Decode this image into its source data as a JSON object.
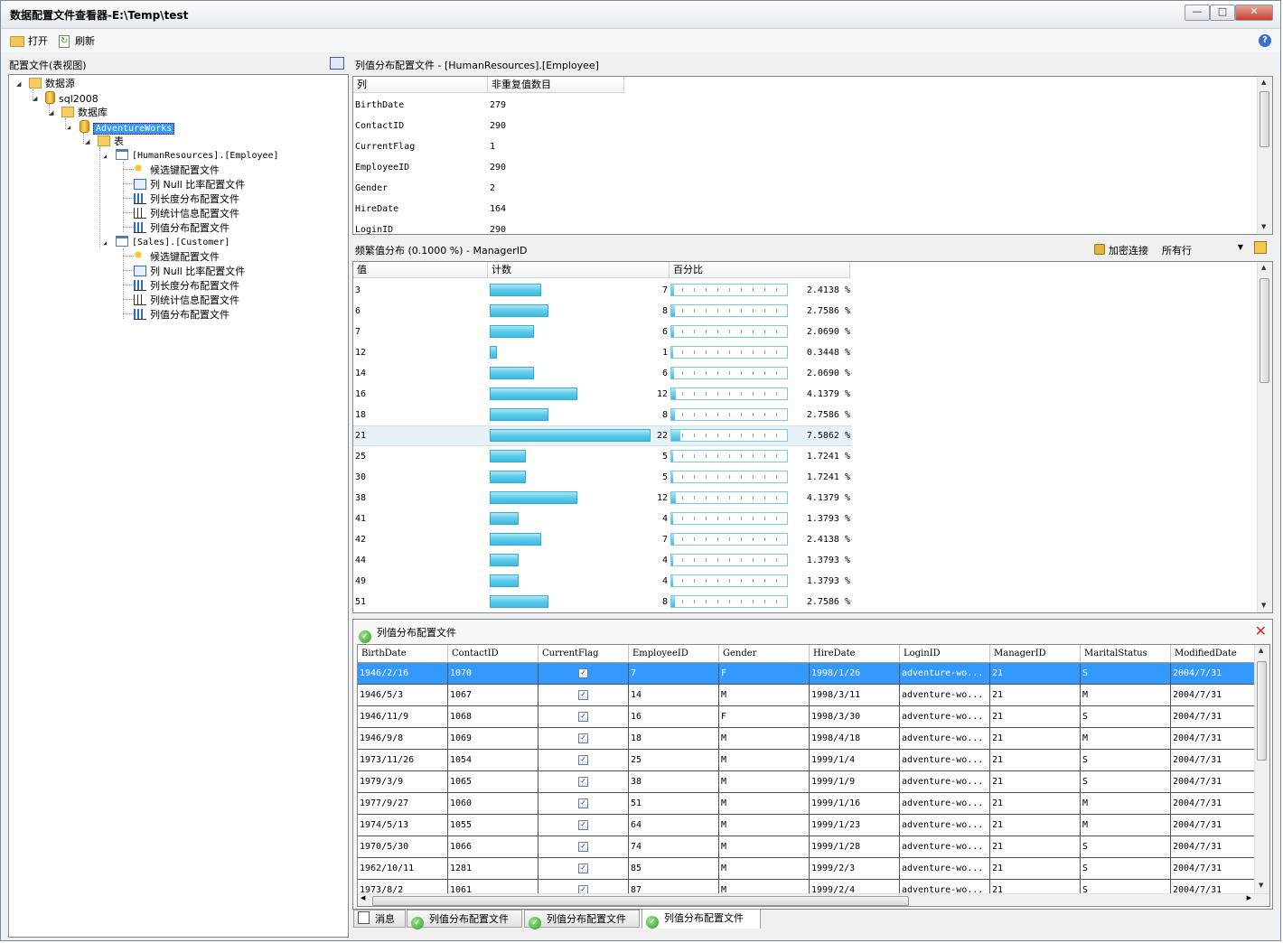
{
  "window": {
    "title": "数据配置文件查看器-E:\\Temp\\test",
    "min": "—",
    "max": "□",
    "close": "✕"
  },
  "toolbar": {
    "open_label": "打开",
    "refresh_label": "刷新",
    "help": "?"
  },
  "left": {
    "header": "配置文件(表视图)",
    "tree": {
      "datasource": "数据源",
      "server": "sql2008",
      "databases": "数据库",
      "db": "AdventureWorks",
      "tables": "表",
      "table1": "[HumanResources].[Employee]",
      "table2": "[Sales].[Customer]",
      "t1_items": [
        "候选键配置文件",
        "列 Null 比率配置文件",
        "列长度分布配置文件",
        "列统计信息配置文件",
        "列值分布配置文件"
      ],
      "t2_items": [
        "候选键配置文件",
        "列 Null 比率配置文件",
        "列长度分布配置文件",
        "列统计信息配置文件",
        "列值分布配置文件"
      ]
    }
  },
  "top_panel": {
    "header": "列值分布配置文件  -  [HumanResources].[Employee]",
    "col_header": "列",
    "count_header": "非重复值数目",
    "rows": [
      {
        "col": "BirthDate",
        "count": "279"
      },
      {
        "col": "ContactID",
        "count": "290"
      },
      {
        "col": "CurrentFlag",
        "count": "1"
      },
      {
        "col": "EmployeeID",
        "count": "290"
      },
      {
        "col": "Gender",
        "count": "2"
      },
      {
        "col": "HireDate",
        "count": "164"
      },
      {
        "col": "LoginID",
        "count": "290"
      }
    ]
  },
  "mid_panel": {
    "header": "频繁值分布 (0.1000 %) - ManagerID",
    "encrypt_label": "加密连接",
    "rows_filter": "所有行",
    "value_header": "值",
    "count_header": "计数",
    "percent_header": "百分比",
    "max_count": 22,
    "rows": [
      {
        "value": "3",
        "count": 7,
        "percent": "2.4138 %",
        "pct": 2.4138
      },
      {
        "value": "6",
        "count": 8,
        "percent": "2.7586 %",
        "pct": 2.7586
      },
      {
        "value": "7",
        "count": 6,
        "percent": "2.0690 %",
        "pct": 2.069
      },
      {
        "value": "12",
        "count": 1,
        "percent": "0.3448 %",
        "pct": 0.3448
      },
      {
        "value": "14",
        "count": 6,
        "percent": "2.0690 %",
        "pct": 2.069
      },
      {
        "value": "16",
        "count": 12,
        "percent": "4.1379 %",
        "pct": 4.1379
      },
      {
        "value": "18",
        "count": 8,
        "percent": "2.7586 %",
        "pct": 2.7586
      },
      {
        "value": "21",
        "count": 22,
        "percent": "7.5862 %",
        "pct": 7.5862,
        "highlight": true
      },
      {
        "value": "25",
        "count": 5,
        "percent": "1.7241 %",
        "pct": 1.7241
      },
      {
        "value": "30",
        "count": 5,
        "percent": "1.7241 %",
        "pct": 1.7241
      },
      {
        "value": "38",
        "count": 12,
        "percent": "4.1379 %",
        "pct": 4.1379
      },
      {
        "value": "41",
        "count": 4,
        "percent": "1.3793 %",
        "pct": 1.3793
      },
      {
        "value": "42",
        "count": 7,
        "percent": "2.4138 %",
        "pct": 2.4138
      },
      {
        "value": "44",
        "count": 4,
        "percent": "1.3793 %",
        "pct": 1.3793
      },
      {
        "value": "49",
        "count": 4,
        "percent": "1.3793 %",
        "pct": 1.3793
      },
      {
        "value": "51",
        "count": 8,
        "percent": "2.7586 %",
        "pct": 2.7586
      }
    ]
  },
  "bottom_panel": {
    "header": "列值分布配置文件",
    "close": "✕",
    "columns": [
      "BirthDate",
      "ContactID",
      "CurrentFlag",
      "EmployeeID",
      "Gender",
      "HireDate",
      "LoginID",
      "ManagerID",
      "MaritalStatus",
      "ModifiedDate"
    ],
    "rows": [
      [
        "1946/2/16",
        "1070",
        "✓",
        "7",
        "F",
        "1998/1/26",
        "adventure-wo...",
        "21",
        "S",
        "2004/7/31"
      ],
      [
        "1946/5/3",
        "1067",
        "✓",
        "14",
        "M",
        "1998/3/11",
        "adventure-wo...",
        "21",
        "M",
        "2004/7/31"
      ],
      [
        "1946/11/9",
        "1068",
        "✓",
        "16",
        "F",
        "1998/3/30",
        "adventure-wo...",
        "21",
        "S",
        "2004/7/31"
      ],
      [
        "1946/9/8",
        "1069",
        "✓",
        "18",
        "M",
        "1998/4/18",
        "adventure-wo...",
        "21",
        "M",
        "2004/7/31"
      ],
      [
        "1973/11/26",
        "1054",
        "✓",
        "25",
        "M",
        "1999/1/4",
        "adventure-wo...",
        "21",
        "S",
        "2004/7/31"
      ],
      [
        "1979/3/9",
        "1065",
        "✓",
        "38",
        "M",
        "1999/1/9",
        "adventure-wo...",
        "21",
        "S",
        "2004/7/31"
      ],
      [
        "1977/9/27",
        "1060",
        "✓",
        "51",
        "M",
        "1999/1/16",
        "adventure-wo...",
        "21",
        "M",
        "2004/7/31"
      ],
      [
        "1974/5/13",
        "1055",
        "✓",
        "64",
        "M",
        "1999/1/23",
        "adventure-wo...",
        "21",
        "M",
        "2004/7/31"
      ],
      [
        "1970/5/30",
        "1066",
        "✓",
        "74",
        "M",
        "1999/1/28",
        "adventure-wo...",
        "21",
        "S",
        "2004/7/31"
      ],
      [
        "1962/10/11",
        "1281",
        "✓",
        "85",
        "M",
        "1999/2/3",
        "adventure-wo...",
        "21",
        "S",
        "2004/7/31"
      ],
      [
        "1973/8/2",
        "1061",
        "✓",
        "87",
        "M",
        "1999/2/4",
        "adventure-wo...",
        "21",
        "S",
        "2004/7/31"
      ]
    ],
    "selected_row": 0
  },
  "tabs": [
    "消息",
    "列值分布配置文件",
    "列值分布配置文件",
    "列值分布配置文件"
  ],
  "colors": {
    "selection": "#3399ff",
    "bar": "#5ccbea",
    "close_red": "#d42a2a"
  }
}
